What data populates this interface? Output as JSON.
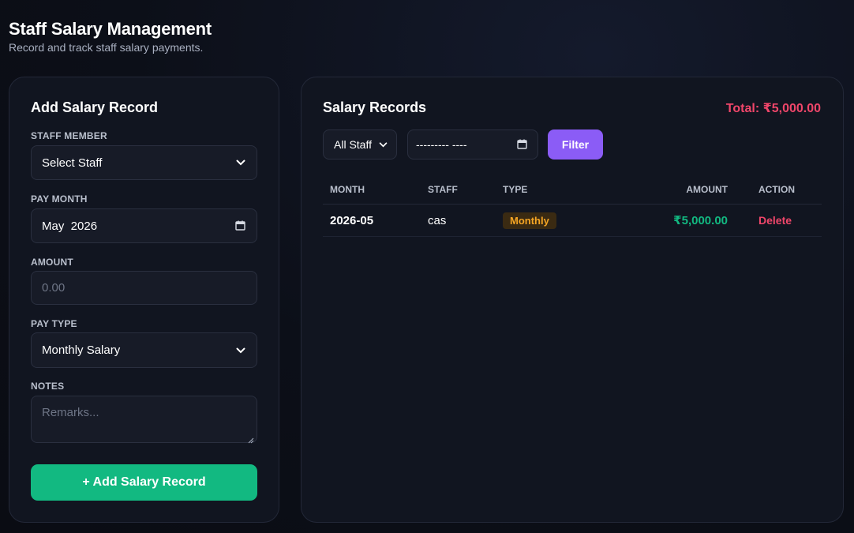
{
  "header": {
    "title": "Staff Salary Management",
    "subtitle": "Record and track staff salary payments."
  },
  "form": {
    "title": "Add Salary Record",
    "staff_label": "STAFF MEMBER",
    "staff_value": "Select Staff",
    "month_label": "PAY MONTH",
    "month_value": "May  2026",
    "amount_label": "AMOUNT",
    "amount_placeholder": "0.00",
    "paytype_label": "PAY TYPE",
    "paytype_value": "Monthly Salary",
    "notes_label": "NOTES",
    "notes_placeholder": "Remarks...",
    "submit_label": "+ Add Salary Record"
  },
  "records": {
    "title": "Salary Records",
    "total": "Total: ₹5,000.00",
    "filter_staff": "All Staff",
    "filter_date": "--------- ----",
    "filter_button": "Filter",
    "columns": [
      "MONTH",
      "STAFF",
      "TYPE",
      "AMOUNT",
      "ACTION"
    ],
    "rows": [
      {
        "month": "2026-05",
        "staff": "cas",
        "type": "Monthly",
        "amount": "₹5,000.00",
        "action": "Delete"
      }
    ]
  },
  "colors": {
    "accent_green": "#12b981",
    "accent_purple": "#8b5cf6",
    "accent_red": "#f0466a",
    "badge_amber": "#f5a524"
  },
  "icons": [
    "chevron-down-icon",
    "calendar-icon",
    "resize-handle-icon"
  ]
}
